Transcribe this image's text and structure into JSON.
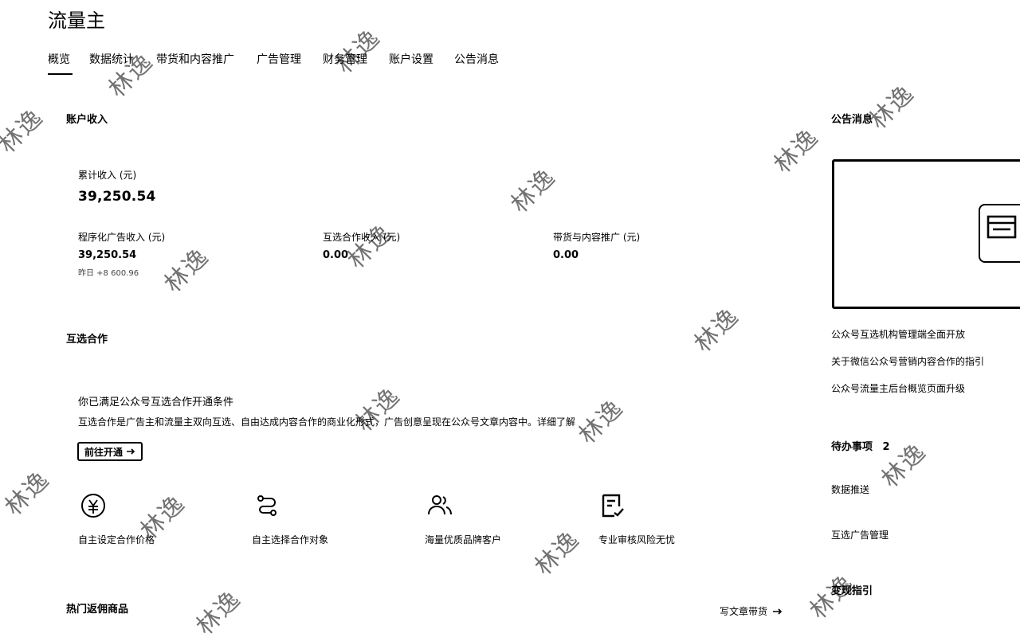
{
  "app": {
    "title": "流量主"
  },
  "tabs": [
    {
      "label": "概览",
      "active": true
    },
    {
      "label": "数据统计"
    },
    {
      "label": "带货和内容推广"
    },
    {
      "label": "广告管理"
    },
    {
      "label": "财务管理"
    },
    {
      "label": "账户设置"
    },
    {
      "label": "公告消息"
    }
  ],
  "income": {
    "section_title": "账户收入",
    "total_label": "累计收入 (元)",
    "total_value": "39,250.54",
    "items": [
      {
        "label": "程序化广告收入 (元)",
        "value": "39,250.54",
        "sub": "昨日 +8 600.96"
      },
      {
        "label": "互选合作收入 (元)",
        "value": "0.00"
      },
      {
        "label": "带货与内容推广 (元)",
        "value": "0.00"
      }
    ]
  },
  "coop": {
    "section_title": "互选合作",
    "heading": "你已满足公众号互选合作开通条件",
    "desc": "互选合作是广告主和流量主双向互选、自由达成内容合作的商业化形式，广告创意呈现在公众号文章内容中。详细了解",
    "button_label": "前往开通",
    "button_icon": "arrow-right-icon",
    "features": [
      {
        "label": "自主设定合作价格",
        "icon": "yuan-icon"
      },
      {
        "label": "自主选择合作对象",
        "icon": "route-icon"
      },
      {
        "label": "海量优质品牌客户",
        "icon": "users-icon"
      },
      {
        "label": "专业审核风险无忧",
        "icon": "document-check-icon"
      }
    ]
  },
  "hot": {
    "section_title": "热门返佣商品",
    "link_label": "写文章带货",
    "link_icon": "arrow-right-icon"
  },
  "sidebar": {
    "announce_title": "公告消息",
    "announcements": [
      "公众号互选机构管理端全面开放",
      "关于微信公众号营销内容合作的指引",
      "公众号流量主后台概览页面升级"
    ],
    "todo_title": "待办事项",
    "todo_count": "2",
    "todo_items": [
      "数据推送",
      "互选广告管理"
    ],
    "guide_title": "变现指引"
  },
  "watermark": {
    "text": "林逸"
  }
}
